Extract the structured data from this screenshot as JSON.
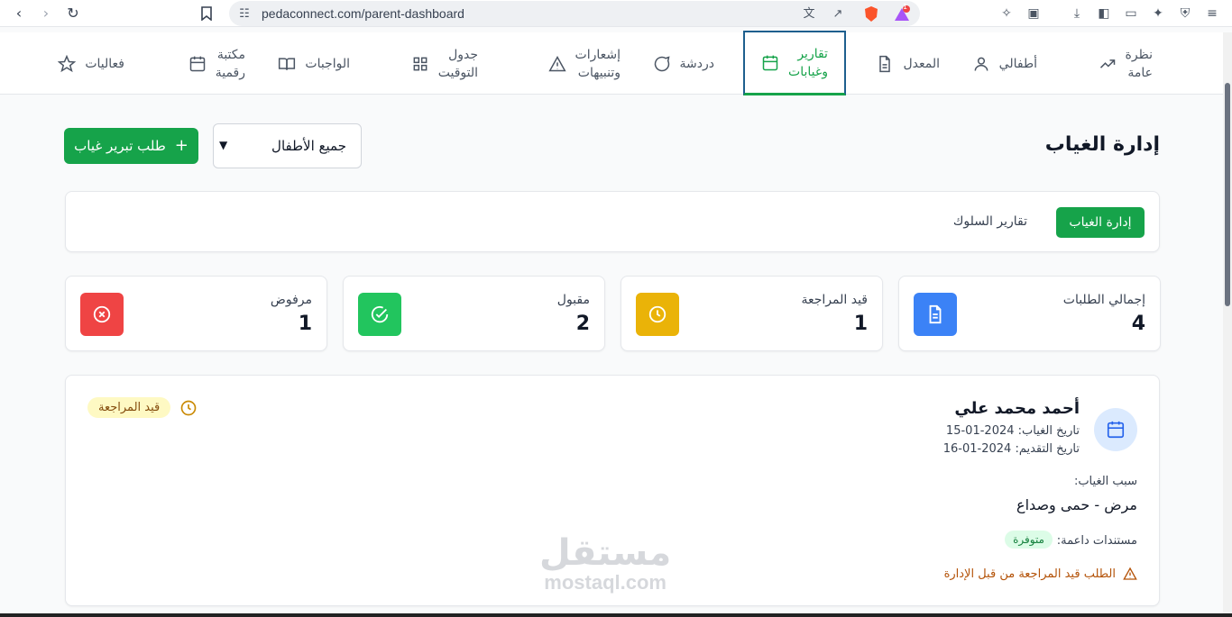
{
  "browser": {
    "url": "pedaconnect.com/parent-dashboard",
    "notification_count": "1"
  },
  "nav": {
    "items": [
      {
        "label": "نظرة\nعامة",
        "icon": "trending-icon"
      },
      {
        "label": "أطفالي",
        "icon": "user-icon"
      },
      {
        "label": "المعدل",
        "icon": "file-icon"
      },
      {
        "label": "تقارير\nوغيابات",
        "icon": "calendar-icon",
        "active": true
      },
      {
        "label": "دردشة",
        "icon": "chat-icon"
      },
      {
        "label": "إشعارات\nوتنبيهات",
        "icon": "alert-icon"
      },
      {
        "label": "جدول\nالتوقيت",
        "icon": "grid-icon"
      },
      {
        "label": "الواجبات",
        "icon": "book-icon"
      },
      {
        "label": "مكتبة\nرقمية",
        "icon": "calendar-icon"
      },
      {
        "label": "فعاليات",
        "icon": "star-icon"
      }
    ]
  },
  "header": {
    "title": "إدارة الغياب",
    "child_select": "جميع الأطفال",
    "new_request": "طلب تبرير غياب"
  },
  "tabs": {
    "active": "إدارة الغياب",
    "other": "تقارير السلوك"
  },
  "stats": [
    {
      "label": "إجمالي الطلبات",
      "value": "4",
      "color": "#3b82f6",
      "icon": "document-icon"
    },
    {
      "label": "قيد المراجعة",
      "value": "1",
      "color": "#eab308",
      "icon": "clock-icon"
    },
    {
      "label": "مقبول",
      "value": "2",
      "color": "#22c55e",
      "icon": "check-circle-icon"
    },
    {
      "label": "مرفوض",
      "value": "1",
      "color": "#ef4444",
      "icon": "x-circle-icon"
    }
  ],
  "request": {
    "name": "أحمد محمد علي",
    "absence_date": "تاريخ الغياب: 2024-01-15",
    "submit_date": "تاريخ التقديم: 2024-01-16",
    "reason_label": "سبب الغياب:",
    "reason": "مرض - حمى وصداع",
    "docs_label": "مستندات داعمة:",
    "docs_status": "متوفرة",
    "status": "قيد المراجعة",
    "warning": "الطلب قيد المراجعة من قبل الإدارة"
  },
  "watermark": {
    "ar": "مستقل",
    "en": "mostaql.com"
  }
}
